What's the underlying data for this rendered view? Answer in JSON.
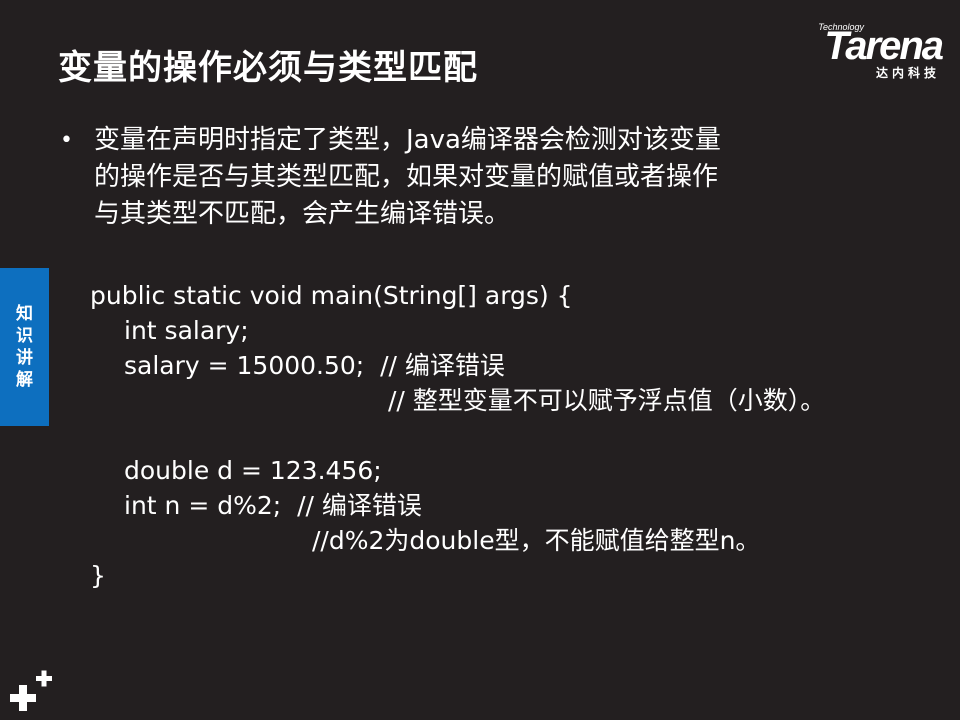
{
  "slide": {
    "title": "变量的操作必须与类型匹配",
    "bullet_char": "•",
    "bullet_lines": [
      "变量在声明时指定了类型，Java编译器会检测对该变量",
      "的操作是否与其类型匹配，如果对变量的赋值或者操作",
      "与其类型不匹配，会产生编译错误。"
    ],
    "sidebar_tab": "知识讲解",
    "code_lines": [
      "public static void main(String[] args) {",
      "int salary;",
      "salary = 15000.50;  // 编译错误",
      "// 整型变量不可以赋予浮点值（小数）。",
      "",
      "double d = 123.456;",
      "int n = d%2;  // 编译错误",
      "//d%2为double型，不能赋值给整型n。",
      "}"
    ]
  },
  "logo": {
    "tagline": "Technology",
    "word": "Tarena",
    "subtitle": "达内科技"
  },
  "icons": {
    "decoration": "plus-cluster-icon"
  },
  "colors": {
    "background": "#231f20",
    "accent_blue": "#0d6fbf",
    "text": "#ffffff"
  }
}
